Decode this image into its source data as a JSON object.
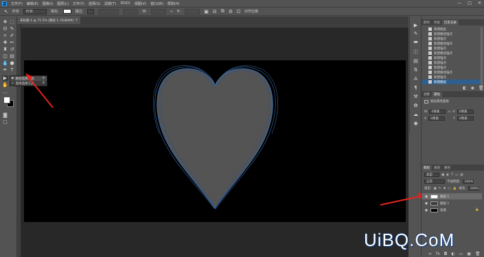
{
  "app": {
    "logo": "Ps"
  },
  "menu": [
    "文件(F)",
    "编辑(E)",
    "图像(I)",
    "图层(L)",
    "文字(Y)",
    "选择(S)",
    "滤镜(T)",
    "3D(D)",
    "视图(V)",
    "窗口(W)",
    "帮助(H)"
  ],
  "window_controls": [
    "—",
    "□",
    "✕"
  ],
  "options_bar": {
    "shape_mode": "形状",
    "fill_label": "填充:",
    "fill_color": "#ffffff",
    "stroke_label": "描边:",
    "stroke_width": "",
    "w_label": "W:",
    "h_label": "H:",
    "align_edges": "对齐边缘"
  },
  "document_tab": {
    "title": "未标题-1 @ 71.5% (图层 1, RGB/8#)",
    "close": "×"
  },
  "tool_flyout": {
    "items": [
      {
        "label": "路径选择工具",
        "shortcut": "A",
        "selected": true
      },
      {
        "label": "直接选择工具",
        "shortcut": "A",
        "selected": false
      }
    ]
  },
  "history_panel": {
    "tabs": [
      "颜色",
      "色板",
      "历史记录"
    ],
    "active_tab": "历史记录",
    "items": [
      "新建图层",
      "新建路径锚点",
      "新建锚点",
      "新建路径锚点",
      "新建锚点",
      "新建路径锚点",
      "新建锚点",
      "新建锚点",
      "新建锚点",
      "新建路径锚点",
      "新建锚点",
      "新建图层"
    ],
    "selected_index": 11
  },
  "properties_panel": {
    "tabs": [
      "调整",
      "属性"
    ],
    "active_tab": "属性",
    "header": "图层属性面板",
    "w_label": "W",
    "w_value": "0像素",
    "h_label": "H",
    "h_value": "0像素",
    "x_label": "X",
    "x_value": "0像素",
    "y_label": "Y",
    "y_value": "0像素"
  },
  "layers_panel": {
    "tabs": [
      "图层",
      "通道",
      "路径"
    ],
    "active_tab": "图层",
    "filter_label": "类型",
    "blend_mode": "正常",
    "opacity_label": "不透明度:",
    "opacity_value": "100%",
    "lock_label": "锁定:",
    "fill_label": "填充:",
    "fill_value": "100%",
    "layers": [
      {
        "name": "图层 1",
        "selected": true,
        "thumb": "#ffffff"
      },
      {
        "name": "图层 1",
        "selected": false,
        "thumb": "#3a3a3a"
      },
      {
        "name": "背景",
        "selected": false,
        "thumb": "#000000"
      }
    ]
  },
  "watermark": "UiBQ.CoM",
  "colors": {
    "accent": "#2f5f8c",
    "arrow": "#e8231d",
    "heart_fill": "#545454",
    "heart_stroke": "#3a6aa8"
  }
}
